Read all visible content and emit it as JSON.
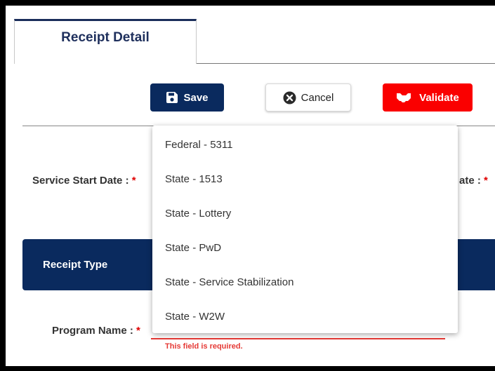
{
  "tab": {
    "label": "Receipt Detail"
  },
  "toolbar": {
    "save_label": "Save",
    "cancel_label": "Cancel",
    "validate_label": "Validate"
  },
  "form": {
    "service_start_label": "Service Start Date :",
    "service_end_label_partial": "ate :",
    "required_marker": "*",
    "receipt_type_label": "Receipt Type",
    "program_name_label": "Program Name :",
    "program_error": "This field is required."
  },
  "dropdown": {
    "options": [
      "Federal - 5311",
      "State - 1513",
      "State - Lottery",
      "State - PwD",
      "State - Service Stabilization",
      "State - W2W"
    ]
  },
  "colors": {
    "primary": "#0a2a5e",
    "danger": "#fa0000",
    "error": "#e53935"
  }
}
